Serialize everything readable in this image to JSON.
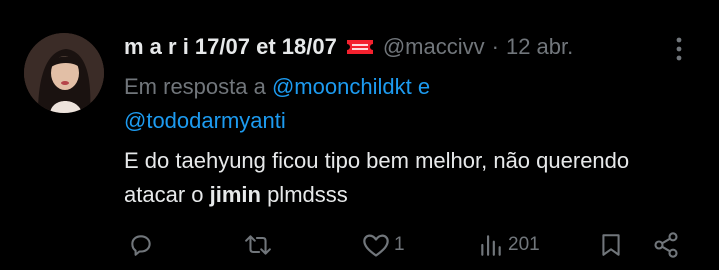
{
  "tweet": {
    "display_name": "m a r i 17/07 et 18/07",
    "badge_icon": "ticket-icon",
    "handle": "@maccivv",
    "separator": "·",
    "timestamp": "12 abr.",
    "reply_prefix": "Em resposta a",
    "reply_user_1": "@moonchildkt",
    "reply_conjunction": "e",
    "reply_user_2": "@tododarmyanti",
    "body_part_1": "E do taehyung ficou tipo bem melhor, não querendo atacar o ",
    "body_bold": "jimin",
    "body_part_2": " plmdsss"
  },
  "actions": {
    "reply_count": "",
    "retweet_count": "",
    "like_count": "1",
    "views_count": "201"
  },
  "colors": {
    "background": "#000000",
    "text_primary": "#e7e9ea",
    "text_secondary": "#71767b",
    "link": "#1d9bf0",
    "ticket": "#f4212e"
  }
}
